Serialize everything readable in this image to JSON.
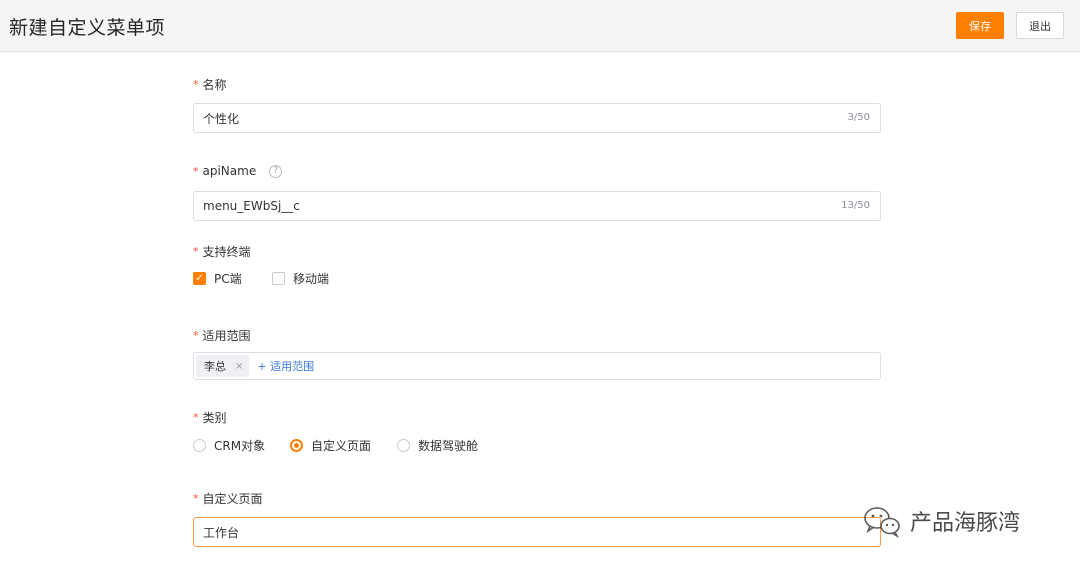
{
  "header": {
    "title": "新建自定义菜单项",
    "save_label": "保存",
    "exit_label": "退出"
  },
  "form": {
    "required_mark": "*",
    "name": {
      "label": "名称",
      "value": "个性化",
      "counter": "3/50"
    },
    "api_name": {
      "label": "apiName",
      "help": "?",
      "value": "menu_EWbSj__c",
      "counter": "13/50"
    },
    "terminals": {
      "label": "支持终端",
      "options": [
        {
          "label": "PC端",
          "checked": true
        },
        {
          "label": "移动端",
          "checked": false
        }
      ]
    },
    "scope": {
      "label": "适用范围",
      "tags": [
        "李总"
      ],
      "tag_close": "×",
      "add_label": "+ 适用范围"
    },
    "category": {
      "label": "类别",
      "options": [
        {
          "label": "CRM对象",
          "selected": false
        },
        {
          "label": "自定义页面",
          "selected": true
        },
        {
          "label": "数据驾驶舱",
          "selected": false
        }
      ]
    },
    "custom_page": {
      "label": "自定义页面",
      "value": "工作台"
    }
  },
  "watermark": {
    "text": "产品海豚湾"
  },
  "colors": {
    "accent": "#ff8000",
    "required": "#ff522d",
    "link": "#3a7bd5"
  }
}
